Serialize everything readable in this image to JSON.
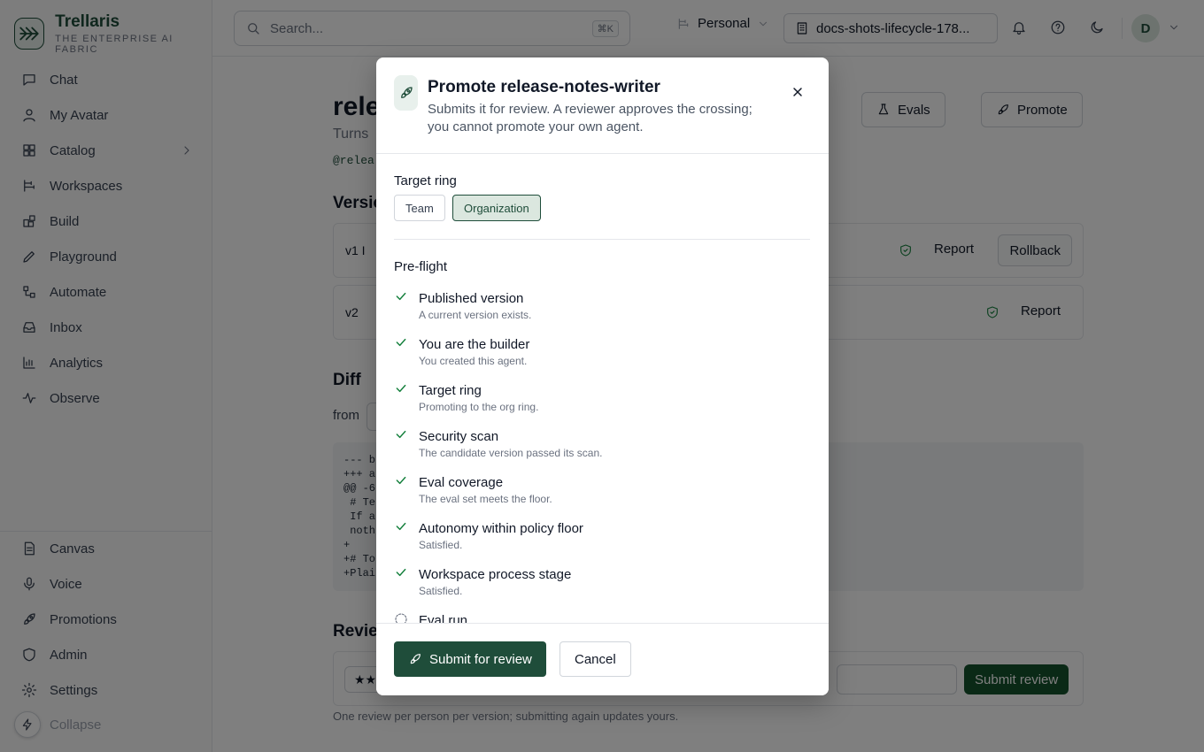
{
  "brand": {
    "name": "Trellaris",
    "tagline": "THE ENTERPRISE AI FABRIC"
  },
  "sidebar": {
    "items": [
      {
        "label": "Chat",
        "icon": "chat-bubble-icon"
      },
      {
        "label": "My Avatar",
        "icon": "user-icon"
      },
      {
        "label": "Catalog",
        "icon": "grid-icon"
      },
      {
        "label": "Workspaces",
        "icon": "workspaces-icon"
      },
      {
        "label": "Build",
        "icon": "blocks-icon"
      },
      {
        "label": "Playground",
        "icon": "pencil-icon"
      },
      {
        "label": "Automate",
        "icon": "workflow-icon"
      },
      {
        "label": "Inbox",
        "icon": "inbox-icon"
      },
      {
        "label": "Analytics",
        "icon": "bar-chart-icon"
      },
      {
        "label": "Observe",
        "icon": "pulse-icon"
      }
    ],
    "bottom_items": [
      {
        "label": "Canvas",
        "icon": "document-icon"
      },
      {
        "label": "Voice",
        "icon": "microphone-icon"
      },
      {
        "label": "Promotions",
        "icon": "rocket-icon"
      },
      {
        "label": "Admin",
        "icon": "shield-icon"
      },
      {
        "label": "Settings",
        "icon": "gear-icon"
      }
    ],
    "collapse_label": "Collapse"
  },
  "topbar": {
    "search_placeholder": "Search...",
    "search_shortcut": "⌘K",
    "workspace": "Personal",
    "project": "docs-shots-lifecycle-178..."
  },
  "user": {
    "initial": "D"
  },
  "page": {
    "title": "rele",
    "subtitle": "Turns",
    "handle": "@relea",
    "evals_label": "Evals",
    "promote_label": "Promote",
    "versions_heading": "Versio",
    "versions": [
      {
        "label": "v1  I",
        "report": "Report",
        "rollback": "Rollback"
      },
      {
        "label": "v2",
        "report": "Report"
      }
    ],
    "diff_heading": "Diff",
    "diff_from": "from",
    "diff_lines": "--- b\n+++ a\n@@ -6\n # Te\n If a\n noth\n+\n+# To\n+Plai",
    "reviews_heading": "Revie",
    "review_stars": "★★",
    "review_submit": "Submit review",
    "review_note": "One review per person per version; submitting again updates yours."
  },
  "modal": {
    "title": "Promote release-notes-writer",
    "description": "Submits it for review. A reviewer approves the crossing; you cannot promote your own agent.",
    "target_ring_label": "Target ring",
    "ring_options": [
      "Team",
      "Organization"
    ],
    "selected_ring": "Organization",
    "preflight_label": "Pre-flight",
    "checks": [
      {
        "title": "Published version",
        "detail": "A current version exists.",
        "status": "pass"
      },
      {
        "title": "You are the builder",
        "detail": "You created this agent.",
        "status": "pass"
      },
      {
        "title": "Target ring",
        "detail": "Promoting to the org ring.",
        "status": "pass"
      },
      {
        "title": "Security scan",
        "detail": "The candidate version passed its scan.",
        "status": "pass"
      },
      {
        "title": "Eval coverage",
        "detail": "The eval set meets the floor.",
        "status": "pass"
      },
      {
        "title": "Autonomy within policy floor",
        "detail": "Satisfied.",
        "status": "pass"
      },
      {
        "title": "Workspace process stage",
        "detail": "Satisfied.",
        "status": "pass"
      },
      {
        "title": "Eval run",
        "detail": "",
        "status": "pending"
      }
    ],
    "submit_label": "Submit for review",
    "cancel_label": "Cancel"
  },
  "colors": {
    "accent": "#1f4d3a",
    "check": "#15803d"
  }
}
